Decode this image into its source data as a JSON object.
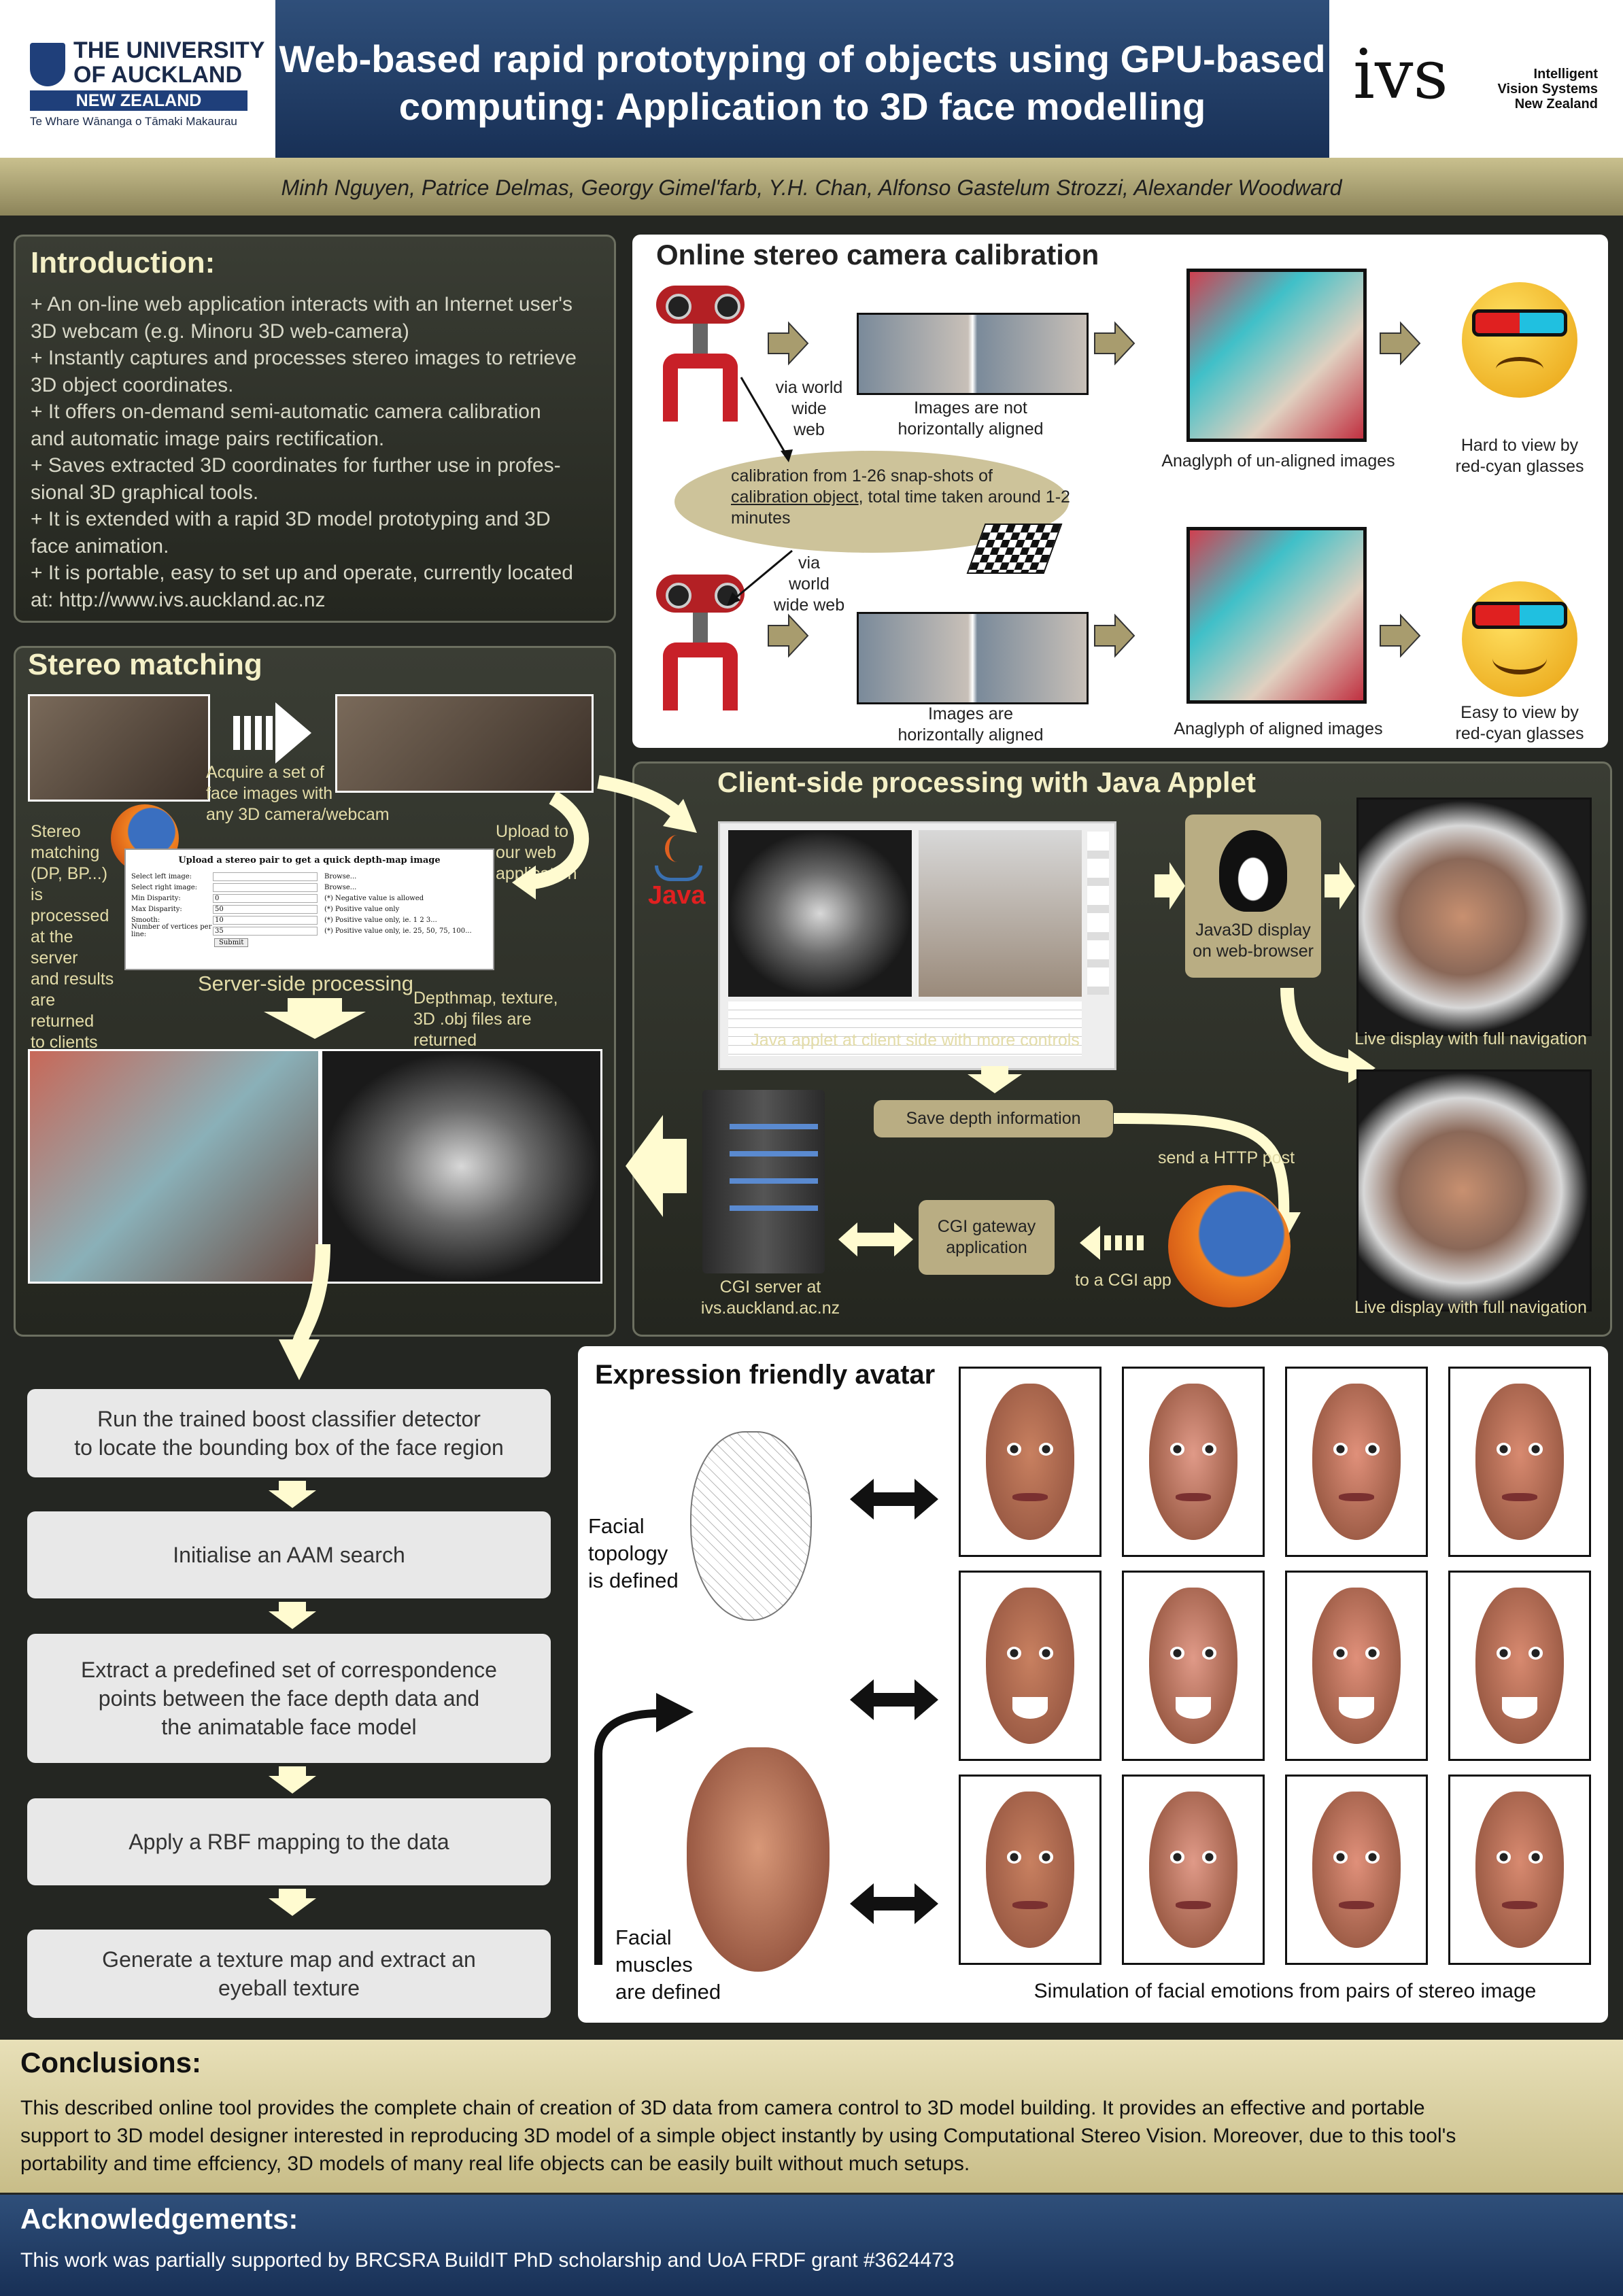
{
  "header": {
    "university_line1": "THE UNIVERSITY",
    "university_line2": "OF AUCKLAND",
    "university_line3": "NEW ZEALAND",
    "university_maori": "Te Whare Wānanga o Tāmaki Makaurau",
    "title_line1": "Web-based rapid prototyping of objects using GPU-based",
    "title_line2": "computing: Application to 3D face modelling",
    "ivs_logo": "ivs",
    "ivs_line1": "Intelligent",
    "ivs_line2": "Vision Systems",
    "ivs_line3": "New Zealand",
    "authors": "Minh Nguyen, Patrice Delmas, Georgy Gimel'farb, Y.H. Chan, Alfonso Gastelum Strozzi, Alexander Woodward"
  },
  "introduction": {
    "title": "Introduction:",
    "lines": [
      "+ An on-line web application interacts with an Internet user's",
      "3D webcam (e.g. Minoru 3D web-camera)",
      "+ Instantly captures and processes stereo images to retrieve",
      "3D object coordinates.",
      "+ It offers on-demand semi-automatic camera calibration",
      "and automatic image pairs rectification.",
      "+ Saves extracted 3D coordinates for further use in profes-",
      "sional 3D graphical tools.",
      "+ It is extended with a rapid 3D model prototyping and 3D",
      "face animation.",
      "+ It is portable, easy to set up and operate, currently located",
      "at: http://www.ivs.auckland.ac.nz"
    ]
  },
  "calibration": {
    "title": "Online stereo camera calibration",
    "via_world_wide_web_1": "via world\nwide\nweb",
    "via_world_wide_web_2": "via\nworld\nwide web",
    "not_aligned": "Images are not\nhorizontally aligned",
    "aligned": "Images are\nhorizontally aligned",
    "anaglyph_unaligned": "Anaglyph of un-aligned images",
    "anaglyph_aligned": "Anaglyph of aligned images",
    "hard_to_view": "Hard to view by\nred-cyan glasses",
    "easy_to_view": "Easy to view by\nred-cyan glasses",
    "ellipse_line1": "calibration from 1-26 snap-shots of",
    "ellipse_line2a": "calibration object",
    "ellipse_line2b": ", total time taken around 1-2",
    "ellipse_line3": "minutes"
  },
  "stereo": {
    "title": "Stereo matching",
    "acquire": "Acquire a set of\nface images with\nany 3D camera/webcam",
    "side_text": "Stereo\nmatching\n(DP, BP...)\nis\nprocessed\nat the\nserver\nand results\nare returned\nto clients",
    "upload": "Upload to\nour web\napplication",
    "server_side": "Server-side processing",
    "depthmap_returned": "Depthmap, texture,\n3D .obj files are\nreturned",
    "form_title": "Upload a stereo pair to get a quick depth-map image",
    "form_rows": [
      {
        "label": "Select left image:",
        "value": "",
        "hint": "Browse..."
      },
      {
        "label": "Select right image:",
        "value": "",
        "hint": "Browse..."
      },
      {
        "label": "Min Disparity:",
        "value": "0",
        "hint": "(*) Negative value is allowed"
      },
      {
        "label": "Max Disparity:",
        "value": "50",
        "hint": "(*) Positive value only"
      },
      {
        "label": "Smooth:",
        "value": "10",
        "hint": "(*) Positive value only, ie. 1 2 3..."
      },
      {
        "label": "Number of vertices per line:",
        "value": "35",
        "hint": "(*) Positive value only, ie. 25, 50, 75, 100..."
      }
    ],
    "form_submit": "Submit"
  },
  "client": {
    "title": "Client-side processing with Java Applet",
    "java_label": "Java",
    "applet_caption": "Java applet at client side with more controls",
    "java3d": "Java3D display\non web-browser",
    "live1": "Live display with full navigation",
    "live2": "Live display with full navigation",
    "save_depth": "Save depth information",
    "send_http": "send a HTTP post",
    "cgi_gateway": "CGI gateway\napplication",
    "to_cgi": "to a CGI app",
    "cgi_server": "CGI server at\nivs.auckland.ac.nz"
  },
  "pipeline": {
    "steps": [
      "Run the trained boost classifier detector\nto locate the bounding box of the face region",
      "Initialise an AAM search",
      "Extract a predefined set of correspondence\npoints between the face depth data and\nthe animatable face model",
      "Apply a RBF mapping to the data",
      "Generate a texture map and extract an\neyeball texture"
    ]
  },
  "avatar": {
    "title": "Expression friendly avatar",
    "topology": "Facial\ntopology\nis defined",
    "muscles": "Facial\nmuscles\nare defined",
    "simulation": "Simulation of facial emotions from pairs of stereo image"
  },
  "conclusions": {
    "title": "Conclusions:",
    "lines": [
      "This described online tool provides the complete chain of creation of 3D data from camera control to 3D model building. It provides an effective and portable",
      "support to 3D model designer interested in reproducing 3D model of a simple object instantly by using Computational Stereo Vision. Moreover, due to this tool's",
      "portability and time effciency, 3D models of many real life objects can be easily built without much setups."
    ]
  },
  "acknowledgements": {
    "title": "Acknowledgements:",
    "text": "This work was partially supported by BRCSRA BuildIT PhD scholarship and UoA FRDF grant #3624473"
  },
  "colors": {
    "header_blue": "#213d66",
    "khaki": "#b9ad83",
    "panel_dark": "#2e3029",
    "title_cream": "#f4f0c7"
  }
}
